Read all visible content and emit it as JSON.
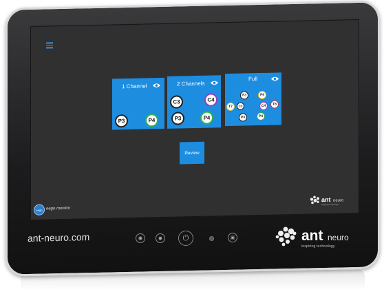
{
  "bezel": {
    "url": "ant-neuro.com"
  },
  "brand": {
    "name_bold": "ant",
    "name_light": "neuro",
    "tagline": "inspiring technology"
  },
  "app": {
    "name": "eego monitor",
    "logo_text": "eego"
  },
  "tiles": [
    {
      "title": "1 Channel",
      "electrodes": [
        {
          "label": "P3",
          "ring": "#222222"
        },
        {
          "label": "P4",
          "ring": "#2cb24a"
        }
      ]
    },
    {
      "title": "2 Channels",
      "electrodes": [
        {
          "label": "C3",
          "ring": "#222222"
        },
        {
          "label": "C4",
          "ring": "#9b3fb8"
        },
        {
          "label": "P3",
          "ring": "#222222"
        },
        {
          "label": "P4",
          "ring": "#2cb24a"
        }
      ]
    },
    {
      "title": "Full",
      "electrodes": [
        {
          "label": "F3",
          "ring": "#222222"
        },
        {
          "label": "F4",
          "ring": "#e0c020"
        },
        {
          "label": "T7",
          "ring": "#e0c020"
        },
        {
          "label": "C3",
          "ring": "#222222"
        },
        {
          "label": "C4",
          "ring": "#9b3fb8"
        },
        {
          "label": "T8",
          "ring": "#e03030"
        },
        {
          "label": "P3",
          "ring": "#222222"
        },
        {
          "label": "P4",
          "ring": "#2cb24a"
        }
      ]
    }
  ],
  "review": {
    "label": "Review"
  },
  "colors": {
    "tile": "#1d8de0",
    "screen": "#303030",
    "accent": "#3a8fd8"
  },
  "icons": [
    "menu-icon",
    "eye-icon",
    "brightness-down-icon",
    "brightness-up-icon",
    "power-icon",
    "camera-icon",
    "screen-icon"
  ]
}
